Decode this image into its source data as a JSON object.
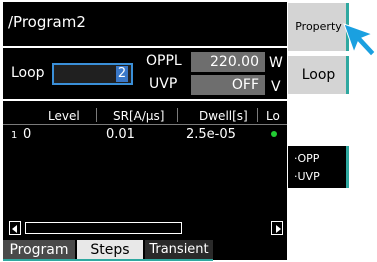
{
  "header": {
    "title": "/Program2"
  },
  "loop": {
    "label": "Loop",
    "value": "2"
  },
  "oppl": {
    "label": "OPPL",
    "value": "220.00",
    "unit": "W"
  },
  "uvp": {
    "label": "UVP",
    "value": "OFF",
    "unit": "V"
  },
  "table": {
    "columns": [
      "Level",
      "SR[A/µs]",
      "Dwell[s]",
      "Lo"
    ],
    "rows": [
      {
        "num": "1",
        "level": "0",
        "sr": "0.01",
        "dwell": "2.5e-05",
        "status": "on"
      }
    ]
  },
  "tabs": [
    {
      "label": "Program"
    },
    {
      "label": "Steps"
    },
    {
      "label": "Transient"
    }
  ],
  "side": {
    "property_label": "Property",
    "loop_label": "Loop",
    "options": [
      "·OPP",
      "·UVP"
    ]
  },
  "colors": {
    "accent": "#2fa8a0",
    "status_on": "#22cc33",
    "selection": "#3a78c8",
    "cursor": "#1aa0e0"
  }
}
